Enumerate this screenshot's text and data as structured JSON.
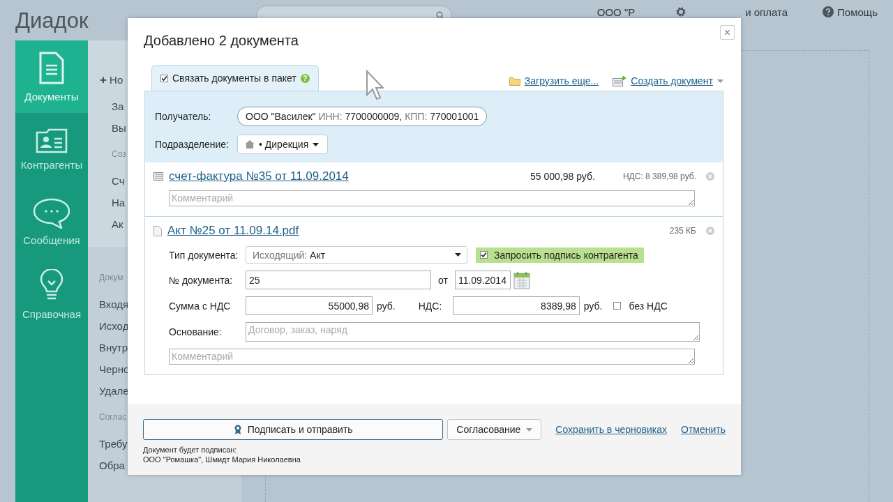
{
  "header": {
    "logo": "Диадок",
    "org": "ООО \"Р",
    "settings": "и оплата",
    "help": "Помощь"
  },
  "nav": [
    {
      "label": "Документы",
      "selected": true
    },
    {
      "label": "Контрагенты",
      "selected": false
    },
    {
      "label": "Сообщения",
      "selected": false
    },
    {
      "label": "Справочная",
      "selected": false
    }
  ],
  "subnav": {
    "top": [
      {
        "kind": "action",
        "symbol": "+",
        "label": "Но"
      },
      {
        "kind": "item",
        "label": "За"
      },
      {
        "kind": "item",
        "label": "Вы"
      },
      {
        "kind": "heading",
        "label": "Соз"
      },
      {
        "kind": "item",
        "label": "Сч"
      },
      {
        "kind": "item",
        "label": "На"
      },
      {
        "kind": "item",
        "label": "Ак"
      }
    ],
    "bottom": [
      {
        "kind": "heading",
        "label": "Докум"
      },
      {
        "kind": "item",
        "label": "Входя"
      },
      {
        "kind": "item",
        "label": "Исход"
      },
      {
        "kind": "item",
        "label": "Внутр"
      },
      {
        "kind": "item",
        "label": "Черно"
      },
      {
        "kind": "item",
        "label": "Удале"
      },
      {
        "kind": "heading",
        "label": "Соглас"
      },
      {
        "kind": "item",
        "label": "Требу"
      },
      {
        "kind": "item",
        "label": "Обра"
      }
    ]
  },
  "dialog": {
    "title": "Добавлено 2 документа",
    "close": "×",
    "package": {
      "label": "Связать документы в пакет",
      "checked": true,
      "help": "?"
    },
    "upload_link": "Загрузить еще...",
    "create_link": "Создать документ",
    "recipient_label": "Получатель:",
    "recipient": [
      {
        "text": "ООО \"Василек\"",
        "muted": false
      },
      {
        "text": "ИНН:",
        "muted": true
      },
      {
        "text": "7700000009,",
        "muted": false
      },
      {
        "text": "КПП:",
        "muted": true
      },
      {
        "text": "770001001",
        "muted": false
      }
    ],
    "division_label": "Подразделение:",
    "division": "• Дирекция",
    "documents": [
      {
        "kind": "invoice",
        "title": "счет-фактура №35 от 11.09.2014",
        "amount": "55 000,98 руб.",
        "vat": "НДС: 8 389,98 руб.",
        "comment_placeholder": "Комментарий"
      },
      {
        "kind": "file",
        "title": "Акт №25 от 11.09.14.pdf",
        "size": "235 КБ",
        "comment_placeholder": "Комментарий",
        "form": {
          "type_label": "Тип документа:",
          "type_direction": "Исходящий:",
          "type_value": "Акт",
          "request_signature": {
            "label": "Запросить подпись контрагента",
            "checked": true
          },
          "number_label": "№ документа:",
          "number": "25",
          "date_sep": "от",
          "date": "11.09.2014",
          "sum_label": "Сумма с НДС",
          "sum": "55000,98",
          "sum_currency": "руб.",
          "vat_label": "НДС:",
          "vat": "8389,98",
          "vat_currency": "руб.",
          "no_vat": {
            "label": "без НДС",
            "checked": false
          },
          "basis_label": "Основание:",
          "basis_placeholder": "Договор, заказ, наряд"
        }
      }
    ],
    "sign_button": "Подписать и отправить",
    "approval_button": "Согласование",
    "save_link": "Сохранить в черновиках",
    "cancel_link": "Отменить",
    "note": [
      "Документ будет подписан:",
      "ООО \"Ромашка\", Шмидт Мария Николаевна"
    ]
  }
}
